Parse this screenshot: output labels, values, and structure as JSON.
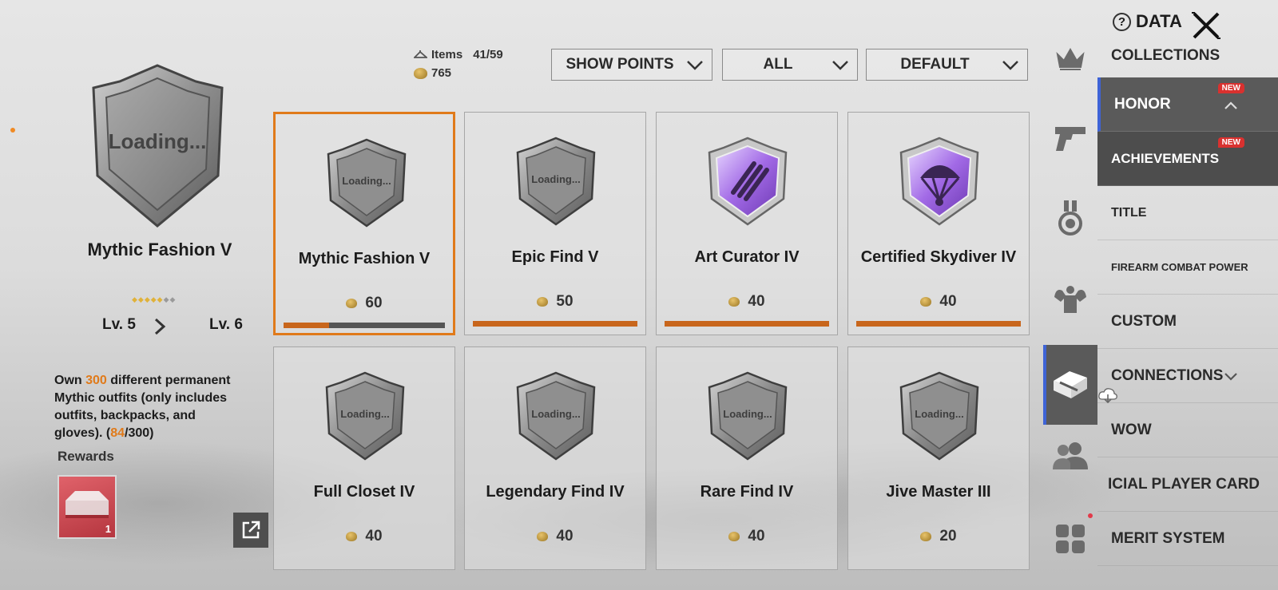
{
  "header": {
    "items_label": "Items",
    "items_count": "41/59",
    "points_total": "765",
    "data_label": "DATA",
    "help_glyph": "?"
  },
  "filters": {
    "show_points": "SHOW POINTS",
    "category": "ALL",
    "sort": "DEFAULT"
  },
  "detail": {
    "badge_text": "Loading...",
    "name": "Mythic Fashion V",
    "stars_filled": 5,
    "stars_total": 7,
    "lv_current": "Lv. 5",
    "lv_next": "Lv. 6",
    "desc_prefix": "Own ",
    "desc_target": "300",
    "desc_mid": " different permanent Mythic outfits (only includes outfits, backpacks, and gloves). (",
    "desc_progress": "84",
    "desc_suffix": "/300)",
    "rewards_label": "Rewards",
    "reward_count": "1"
  },
  "achievements": [
    {
      "title": "Mythic Fashion V",
      "points": "60",
      "badge": "loading",
      "badge_text": "Loading...",
      "progress": 0.28,
      "selected": true
    },
    {
      "title": "Epic Find V",
      "points": "50",
      "badge": "loading",
      "badge_text": "Loading...",
      "progress": 1.0,
      "selected": false
    },
    {
      "title": "Art Curator IV",
      "points": "40",
      "badge": "purple-claw",
      "badge_text": "",
      "progress": 1.0,
      "selected": false
    },
    {
      "title": "Certified Skydiver IV",
      "points": "40",
      "badge": "purple-parachute",
      "badge_text": "",
      "progress": 1.0,
      "selected": false
    },
    {
      "title": "Full Closet IV",
      "points": "40",
      "badge": "loading",
      "badge_text": "Loading...",
      "progress": null,
      "selected": false
    },
    {
      "title": "Legendary Find IV",
      "points": "40",
      "badge": "loading",
      "badge_text": "Loading...",
      "progress": null,
      "selected": false
    },
    {
      "title": "Rare Find IV",
      "points": "40",
      "badge": "loading",
      "badge_text": "Loading...",
      "progress": null,
      "selected": false
    },
    {
      "title": "Jive Master III",
      "points": "20",
      "badge": "loading",
      "badge_text": "Loading...",
      "progress": null,
      "selected": false
    }
  ],
  "rail_icons": [
    "crown-icon",
    "pistol-icon",
    "medal-icon",
    "muscle-icon",
    "collection-chest-icon",
    "friends-icon",
    "grid-apps-icon"
  ],
  "menu": {
    "collections": "COLLECTIONS",
    "honor": "HONOR",
    "achievements": "ACHIEVEMENTS",
    "title": "TITLE",
    "firearm": "FIREARM COMBAT POWER",
    "custom": "CUSTOM",
    "connections": "CONNECTIONS",
    "wow": "WOW",
    "player_card": "ICIAL PLAYER CARD",
    "merit": "MERIT SYSTEM",
    "new_tag": "NEW"
  },
  "colors": {
    "accent": "#e07a1a",
    "active_indicator": "#3e63d6",
    "new_tag": "#d9312f"
  }
}
